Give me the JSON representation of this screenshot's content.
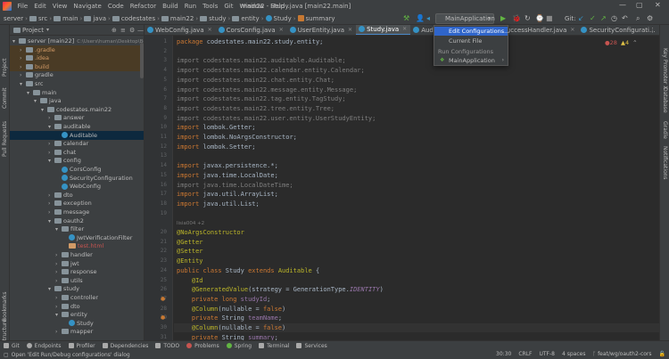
{
  "menubar": {
    "items": [
      "File",
      "Edit",
      "View",
      "Navigate",
      "Code",
      "Refactor",
      "Build",
      "Run",
      "Tools",
      "Git",
      "Window",
      "Help"
    ],
    "window_title": "main22 - Study.java [main22.main]"
  },
  "navbar": {
    "crumbs": [
      "server",
      "src",
      "main",
      "java",
      "codestates",
      "main22",
      "study",
      "entity",
      "Study",
      "summary"
    ],
    "run_config": "MainApplication",
    "git_label": "Git:"
  },
  "left_strip": [
    "Project",
    "Commit",
    "Pull Requests",
    "Bookmarks",
    "Structure"
  ],
  "right_strip": [
    "Key Promoter X",
    "Database",
    "Gradle",
    "Notifications"
  ],
  "project_panel": {
    "header": "Project",
    "rows": [
      {
        "indent": 0,
        "arrow": "▾",
        "icon": "folder",
        "text": "server [main22]",
        "extra": "C:\\Users\\human\\Desktop\\Bootc"
      },
      {
        "indent": 1,
        "arrow": "›",
        "icon": "folder",
        "text": ".gradle",
        "style": "orange"
      },
      {
        "indent": 1,
        "arrow": "›",
        "icon": "folder",
        "text": ".idea",
        "style": "orange"
      },
      {
        "indent": 1,
        "arrow": "›",
        "icon": "folder",
        "text": "build",
        "style": "orange"
      },
      {
        "indent": 1,
        "arrow": "›",
        "icon": "folder",
        "text": "gradle"
      },
      {
        "indent": 1,
        "arrow": "▾",
        "icon": "folder",
        "text": "src"
      },
      {
        "indent": 2,
        "arrow": "▾",
        "icon": "folder",
        "text": "main"
      },
      {
        "indent": 3,
        "arrow": "▾",
        "icon": "folder",
        "text": "java"
      },
      {
        "indent": 4,
        "arrow": "▾",
        "icon": "folder",
        "text": "codestates.main22"
      },
      {
        "indent": 5,
        "arrow": "›",
        "icon": "folder",
        "text": "answer"
      },
      {
        "indent": 5,
        "arrow": "▾",
        "icon": "folder",
        "text": "auditable"
      },
      {
        "indent": 6,
        "arrow": "",
        "icon": "class",
        "text": "Auditable",
        "selected": true
      },
      {
        "indent": 5,
        "arrow": "›",
        "icon": "folder",
        "text": "calendar"
      },
      {
        "indent": 5,
        "arrow": "›",
        "icon": "folder",
        "text": "chat"
      },
      {
        "indent": 5,
        "arrow": "▾",
        "icon": "folder",
        "text": "config"
      },
      {
        "indent": 6,
        "arrow": "",
        "icon": "class",
        "text": "CorsConfig"
      },
      {
        "indent": 6,
        "arrow": "",
        "icon": "class",
        "text": "SecurityConfiguration"
      },
      {
        "indent": 6,
        "arrow": "",
        "icon": "class",
        "text": "WebConfig"
      },
      {
        "indent": 5,
        "arrow": "›",
        "icon": "folder",
        "text": "dto"
      },
      {
        "indent": 5,
        "arrow": "›",
        "icon": "folder",
        "text": "exception"
      },
      {
        "indent": 5,
        "arrow": "›",
        "icon": "folder",
        "text": "message"
      },
      {
        "indent": 5,
        "arrow": "▾",
        "icon": "folder",
        "text": "oauth2"
      },
      {
        "indent": 6,
        "arrow": "▾",
        "icon": "folder",
        "text": "filter"
      },
      {
        "indent": 7,
        "arrow": "",
        "icon": "class",
        "text": "JwtVerificationFilter"
      },
      {
        "indent": 7,
        "arrow": "",
        "icon": "file",
        "text": "test.html",
        "style": "red"
      },
      {
        "indent": 6,
        "arrow": "›",
        "icon": "folder",
        "text": "handler"
      },
      {
        "indent": 6,
        "arrow": "›",
        "icon": "folder",
        "text": "jwt"
      },
      {
        "indent": 6,
        "arrow": "›",
        "icon": "folder",
        "text": "response"
      },
      {
        "indent": 6,
        "arrow": "›",
        "icon": "folder",
        "text": "utils"
      },
      {
        "indent": 5,
        "arrow": "▾",
        "icon": "folder",
        "text": "study"
      },
      {
        "indent": 6,
        "arrow": "›",
        "icon": "folder",
        "text": "controller"
      },
      {
        "indent": 6,
        "arrow": "›",
        "icon": "folder",
        "text": "dto"
      },
      {
        "indent": 6,
        "arrow": "▾",
        "icon": "folder",
        "text": "entity"
      },
      {
        "indent": 7,
        "arrow": "",
        "icon": "class",
        "text": "Study"
      },
      {
        "indent": 6,
        "arrow": "›",
        "icon": "folder",
        "text": "mapper"
      }
    ]
  },
  "tabs": [
    {
      "label": "WebConfig.java",
      "active": false
    },
    {
      "label": "CorsConfig.java",
      "active": false
    },
    {
      "label": "UserEntity.java",
      "active": false
    },
    {
      "label": "Study.java",
      "active": true
    },
    {
      "label": "Auditable.java",
      "active": false
    },
    {
      "label": "UserSuccessHandler.java",
      "active": false
    },
    {
      "label": "SecurityConfigurati...",
      "active": false
    }
  ],
  "editor": {
    "warnings": "28",
    "warn2": "4",
    "lines": [
      {
        "n": "1",
        "html": "<span class='k'>package</span> codestates.main22.study.entity;"
      },
      {
        "n": "2",
        "html": ""
      },
      {
        "n": "3",
        "html": "<span class='g'>import codestates.main22.auditable.Auditable;</span>"
      },
      {
        "n": "4",
        "html": "<span class='g'>import codestates.main22.calendar.entity.Calendar;</span>"
      },
      {
        "n": "5",
        "html": "<span class='g'>import codestates.main22.chat.entity.Chat;</span>"
      },
      {
        "n": "6",
        "html": "<span class='g'>import codestates.main22.message.entity.Message;</span>"
      },
      {
        "n": "7",
        "html": "<span class='g'>import codestates.main22.tag.entity.TagStudy;</span>"
      },
      {
        "n": "8",
        "html": "<span class='g'>import codestates.main22.tree.entity.Tree;</span>"
      },
      {
        "n": "9",
        "html": "<span class='g'>import codestates.main22.user.entity.UserStudyEntity;</span>"
      },
      {
        "n": "10",
        "html": "<span class='k'>import</span> lombok.Getter;"
      },
      {
        "n": "11",
        "html": "<span class='k'>import</span> lombok.NoArgsConstructor;"
      },
      {
        "n": "12",
        "html": "<span class='k'>import</span> lombok.Setter;"
      },
      {
        "n": "13",
        "html": ""
      },
      {
        "n": "14",
        "html": "<span class='k'>import</span> javax.persistence.*;"
      },
      {
        "n": "15",
        "html": "<span class='k'>import</span> java.time.LocalDate;"
      },
      {
        "n": "16",
        "html": "<span class='g'>import java.time.LocalDateTime;</span>"
      },
      {
        "n": "17",
        "html": "<span class='k'>import</span> java.util.ArrayList;"
      },
      {
        "n": "18",
        "html": "<span class='k'>import</span> java.util.List;"
      },
      {
        "n": "19",
        "html": ""
      },
      {
        "n": "",
        "html": "<span class='hint'>lisia004 +2</span>"
      },
      {
        "n": "20",
        "html": "<span class='a'>@NoArgsConstructor</span>"
      },
      {
        "n": "21",
        "html": "<span class='a'>@Getter</span>"
      },
      {
        "n": "22",
        "html": "<span class='a'>@Setter</span>"
      },
      {
        "n": "23",
        "html": "<span class='a'>@Entity</span>"
      },
      {
        "n": "24",
        "html": "<span class='k'>public class</span> Study <span class='k'>extends</span> <span class='a'>Auditable</span> {"
      },
      {
        "n": "25",
        "html": "    <span class='a'>@Id</span>"
      },
      {
        "n": "26",
        "html": "    <span class='a'>@GeneratedValue</span>(strategy = GenerationType.<span class='it'>IDENTITY</span>)"
      },
      {
        "n": "27",
        "html": "    <span class='k'>private long</span> <span class='p'>studyId</span>;"
      },
      {
        "n": "28",
        "html": "    <span class='a'>@Column</span>(nullable = <span class='k'>false</span>)"
      },
      {
        "n": "29",
        "html": "    <span class='k'>private</span> String <span class='p'>teamName</span>;"
      },
      {
        "n": "30",
        "html": "    <span class='a'>@Column</span>(nullable = <span class='k'>false</span>)"
      },
      {
        "n": "31",
        "html": "    <span class='k'>private</span> String <span class='p'>summary</span>;"
      }
    ]
  },
  "dropdown": {
    "items": [
      {
        "label": "Edit Configurations...",
        "selected": true
      },
      {
        "label": "Current File",
        "selected": false
      }
    ],
    "section": "Run Configurations",
    "config_item": "MainApplication"
  },
  "toolstrip": [
    "Git",
    "Endpoints",
    "Profiler",
    "Dependencies",
    "TODO",
    "Problems",
    "Spring",
    "Terminal",
    "Services"
  ],
  "statusbar": {
    "message": "Open 'Edit Run/Debug configurations' dialog",
    "position": "30:30",
    "line_sep": "CRLF",
    "encoding": "UTF-8",
    "indent": "4 spaces",
    "branch": "feat/wg/oauth2-cors"
  }
}
